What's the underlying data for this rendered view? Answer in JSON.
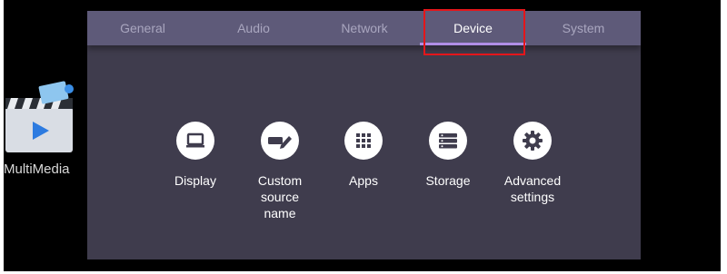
{
  "desktop": {
    "app_label": "MultiMedia"
  },
  "tabs": [
    {
      "label": "General"
    },
    {
      "label": "Audio"
    },
    {
      "label": "Network"
    },
    {
      "label": "Device"
    },
    {
      "label": "System"
    }
  ],
  "active_tab": "Device",
  "options": [
    {
      "label": "Display",
      "icon": "monitor-icon"
    },
    {
      "label": "Custom\nsource\nname",
      "icon": "edit-icon"
    },
    {
      "label": "Apps",
      "icon": "grid-icon"
    },
    {
      "label": "Storage",
      "icon": "storage-icon"
    },
    {
      "label": "Advanced\nsettings",
      "icon": "gear-icon"
    }
  ],
  "colors": {
    "panel_bg": "#3f3c4d",
    "tabbar_bg": "#5e5a79",
    "active_underline": "#b08ee6",
    "highlight_box": "#e4161b"
  }
}
